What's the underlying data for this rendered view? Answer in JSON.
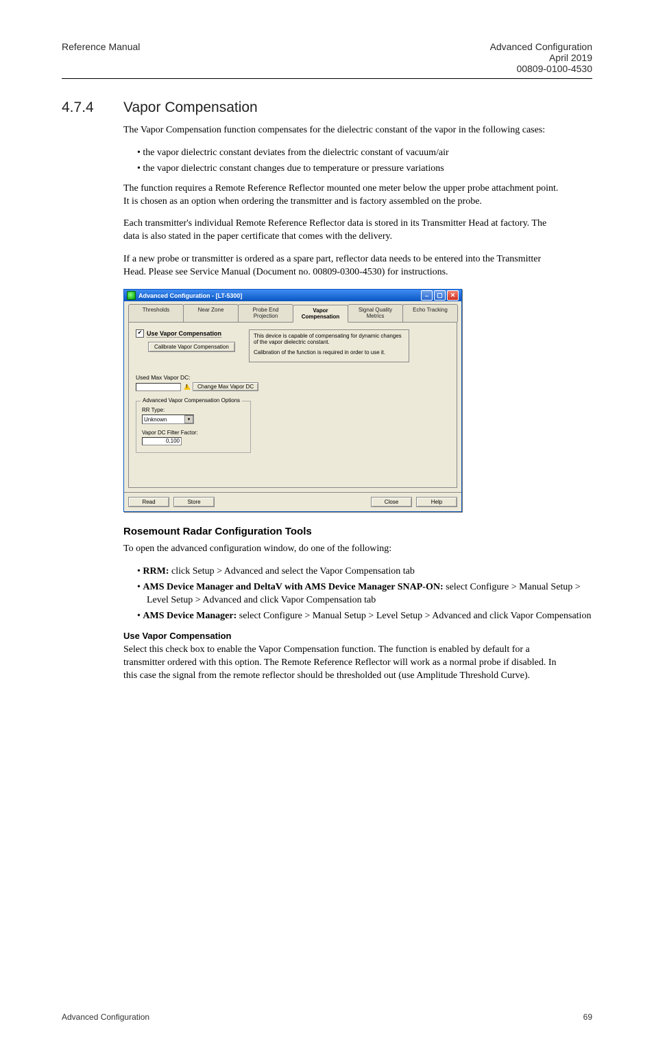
{
  "header": {
    "left": "Reference Manual",
    "right_line1": "Advanced Configuration",
    "right_line2": "April 2019",
    "right_line3": "00809-0100-4530"
  },
  "section": {
    "number": "4.7.4",
    "title": "Vapor Compensation"
  },
  "intro": "The Vapor Compensation function compensates for the dielectric constant of the vapor in the following cases:",
  "bullets": [
    "the vapor dielectric constant deviates from the dielectric constant of vacuum/air",
    "the vapor dielectric constant changes due to temperature or pressure variations"
  ],
  "para1": "The function requires a Remote Reference Reflector mounted one meter below the upper probe attachment point. It is chosen as an option when ordering the transmitter and is factory assembled on the probe.",
  "para2": "Each transmitter's individual Remote Reference Reflector data is stored in its Transmitter Head at factory. The data is also stated in the paper certificate that comes with the delivery.",
  "para3": "If a new probe or transmitter is ordered as a spare part, reflector data needs to be entered into the Transmitter Head. Please see Service Manual (Document no. 00809-0300-4530) for instructions.",
  "window": {
    "title": "Advanced Configuration - [LT-5300]",
    "tabs": {
      "thresholds": "Thresholds",
      "nearzone": "Near Zone",
      "probeend": "Probe End Projection",
      "vaporcomp": "Vapor Compensation",
      "sqm": "Signal Quality Metrics",
      "echo": "Echo Tracking"
    },
    "checkbox_label": "Use Vapor Compensation",
    "calibrate_button": "Calibrate Vapor Compensation",
    "info_line1": "This device is capable of compensating for dynamic changes of the vapor dielectric constant.",
    "info_line2": "Calibration of the function is required in order to use it.",
    "used_max_label": "Used Max Vapor DC:",
    "used_max_value": "",
    "change_btn": "Change Max Vapor DC",
    "group_title": "Advanced Vapor Compensation Options",
    "rr_type_label": "RR Type:",
    "rr_type_value": "Unknown",
    "filter_label": "Vapor DC Filter Factor:",
    "filter_value": "0,100",
    "buttons": {
      "read": "Read",
      "store": "Store",
      "close": "Close",
      "help": "Help"
    }
  },
  "post": {
    "rct_title": "Rosemount Radar Configuration Tools",
    "procedure_lead": "To open the advanced configuration window, do one of the following:",
    "rrm_label": "RRM: ",
    "rrm_text": "click Setup > Advanced and select the Vapor Compensation tab",
    "amssnap_label": "AMS Device Manager and DeltaV with AMS Device Manager SNAP-ON: ",
    "amssnap_text": "select Configure > Manual Setup > Level Setup > Advanced and click Vapor Compensation tab",
    "ams_label": "AMS Device Manager: ",
    "ams_text": "select Configure > Manual Setup > Level Setup > Advanced and click Vapor Compensation",
    "usevapor_label": "Use Vapor Compensation",
    "usevapor_text": "Select this check box to enable the Vapor Compensation function. The function is enabled by default for a transmitter ordered with this option. The Remote Reference Reflector will work as a normal probe if disabled. In this case the signal from the remote reflector should be thresholded out (use Amplitude Threshold Curve)."
  },
  "footer": {
    "left": "Advanced Configuration",
    "right": "69"
  }
}
